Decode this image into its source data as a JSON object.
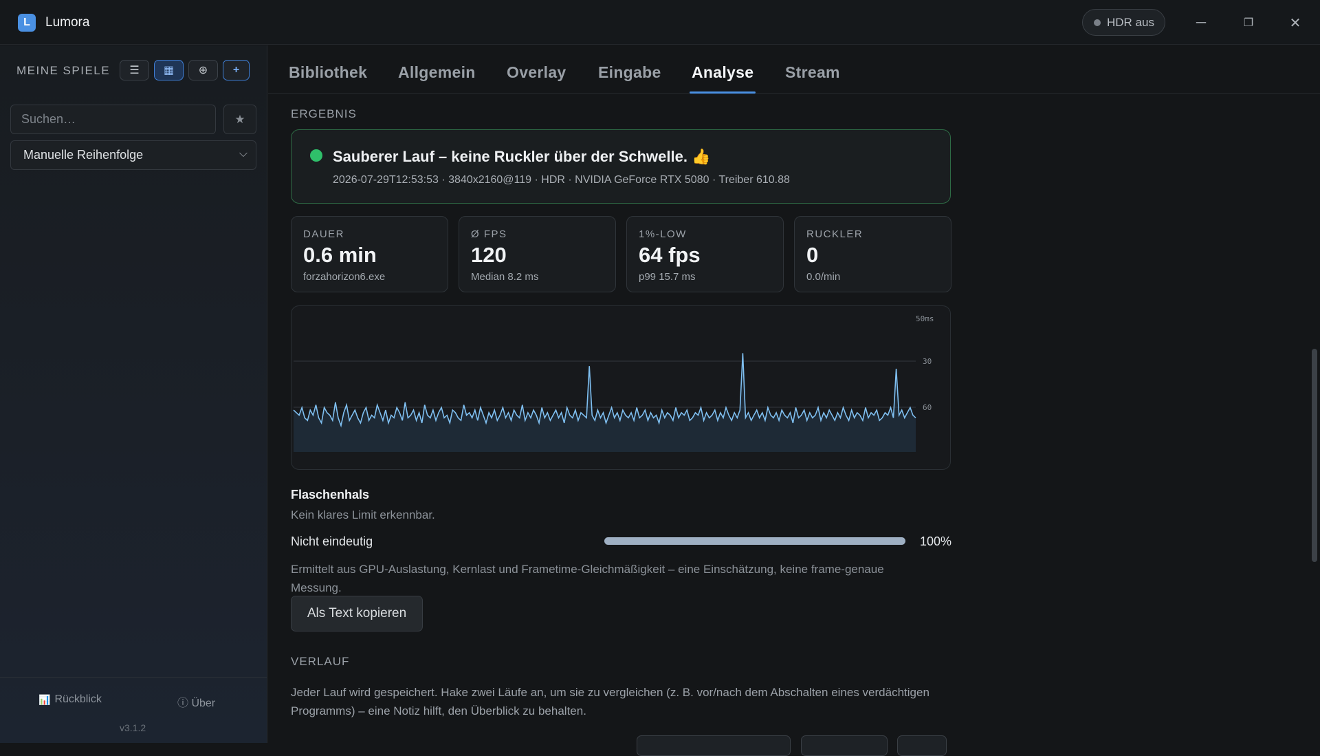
{
  "window": {
    "app_title": "Lumora",
    "logo_letter": "L",
    "hdr_label": "HDR aus",
    "minimize_glyph": "─",
    "restore_glyph": "❐",
    "close_glyph": "✕"
  },
  "sidebar": {
    "heading": "MEINE SPIELE",
    "tools": [
      "☰",
      "▦",
      "⊕",
      "+"
    ],
    "search_placeholder": "Suchen…",
    "star_glyph": "★",
    "sort_value": "Manuelle Reihenfolge",
    "sort_chevron": "⌵",
    "footer_review": "Rückblick",
    "footer_review_icon": "📊",
    "footer_about": "ⓘ Über",
    "version": "v3.1.2"
  },
  "tabs": [
    "Bibliothek",
    "Allgemein",
    "Overlay",
    "Eingabe",
    "Analyse",
    "Stream"
  ],
  "active_tab": "Analyse",
  "result": {
    "section": "ERGEBNIS",
    "title": "Sauberer Lauf – keine Ruckler über der Schwelle. 👍",
    "meta": "2026-07-29T12:53:53 · 3840x2160@119 · HDR · NVIDIA GeForce RTX 5080 · Treiber 610.88",
    "status_color": "#2fbf6a"
  },
  "stats": [
    {
      "label": "DAUER",
      "value": "0.6 min",
      "sub": "forzahorizon6.exe"
    },
    {
      "label": "Ø FPS",
      "value": "120",
      "sub": "Median 8.2 ms"
    },
    {
      "label": "1%-LOW",
      "value": "64 fps",
      "sub": "p99 15.7 ms"
    },
    {
      "label": "RUCKLER",
      "value": "0",
      "sub": "0.0/min"
    }
  ],
  "chart_data": {
    "type": "line",
    "title": "",
    "xlabel": "",
    "ylabel": "",
    "y_tick_labels": [
      "50ms",
      "30",
      "60"
    ],
    "grid": true,
    "series": [
      {
        "color": "#7fbff0",
        "values": [
          13,
          12,
          11,
          14,
          10,
          9,
          13,
          11,
          15,
          10,
          8,
          14,
          12,
          11,
          9,
          16,
          10,
          7,
          12,
          15,
          9,
          11,
          13,
          10,
          8,
          12,
          14,
          9,
          11,
          10,
          15,
          12,
          9,
          13,
          8,
          11,
          10,
          14,
          12,
          9,
          16,
          10,
          11,
          13,
          9,
          12,
          8,
          15,
          11,
          10,
          13,
          9,
          12,
          14,
          10,
          11,
          8,
          13,
          12,
          10,
          9,
          15,
          11,
          12,
          10,
          13,
          9,
          14,
          11,
          8,
          12,
          10,
          13,
          9,
          11,
          14,
          10,
          12,
          9,
          13,
          11,
          10,
          15,
          9,
          12,
          10,
          13,
          11,
          8,
          14,
          10,
          12,
          9,
          11,
          13,
          10,
          12,
          8,
          14,
          11,
          10,
          13,
          9,
          12,
          11,
          10,
          30,
          11,
          9,
          13,
          10,
          12,
          8,
          11,
          14,
          10,
          12,
          9,
          13,
          11,
          10,
          12,
          9,
          14,
          10,
          11,
          13,
          9,
          12,
          10,
          11,
          8,
          13,
          10,
          12,
          11,
          9,
          14,
          10,
          12,
          11,
          13,
          9,
          10,
          12,
          11,
          14,
          9,
          12,
          10,
          11,
          13,
          9,
          12,
          10,
          14,
          11,
          9,
          12,
          10,
          13,
          35,
          10,
          12,
          9,
          11,
          13,
          10,
          12,
          9,
          14,
          11,
          10,
          12,
          9,
          13,
          11,
          10,
          12,
          8,
          14,
          10,
          11,
          13,
          9,
          12,
          10,
          11,
          14,
          9,
          12,
          10,
          13,
          11,
          9,
          12,
          10,
          14,
          11,
          9,
          13,
          10,
          12,
          11,
          9,
          14,
          10,
          12,
          11,
          13,
          9,
          10,
          12,
          11,
          14,
          10,
          29,
          11,
          13,
          10,
          12,
          14,
          11,
          10
        ]
      }
    ]
  },
  "bottleneck": {
    "title": "Flaschenhals",
    "subtitle": "Kein klares Limit erkennbar.",
    "label": "Nicht eindeutig",
    "value": 1.0,
    "percent_label": "100%",
    "note": "Ermittelt aus GPU-Auslastung, Kernlast und Frametime-Gleichmäßigkeit – eine Einschätzung, keine frame-genaue Messung.",
    "copy_button": "Als Text kopieren"
  },
  "history": {
    "section": "VERLAUF",
    "note": "Jeder Lauf wird gespeichert. Hake zwei Läufe an, um sie zu vergleichen (z. B. vor/nach dem Abschalten eines verdächtigen Programms) – eine Notiz hilft, den Überblick zu behalten."
  },
  "colors": {
    "accent": "#4a90e2",
    "success": "#2fbf6a",
    "line": "#7fbff0"
  }
}
